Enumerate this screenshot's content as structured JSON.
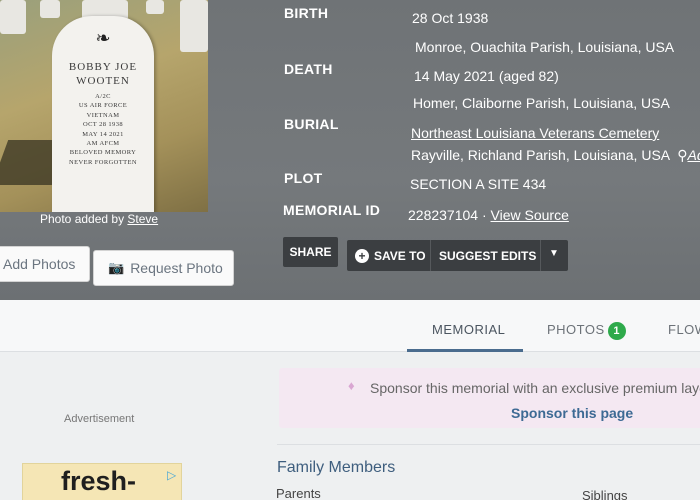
{
  "photo": {
    "headstone": {
      "name_line1": "BOBBY JOE",
      "name_line2": "WOOTEN",
      "lines": [
        "A/2C",
        "US AIR FORCE",
        "VIETNAM",
        "OCT 28 1938",
        "MAY 14 2021",
        "AM AFCM",
        "BELOVED MEMORY",
        "NEVER FORGOTTEN"
      ]
    },
    "credit_prefix": "Photo added by",
    "credit_user": "Steve",
    "add_photos_label": "Add Photos",
    "request_photo_label": "Request Photo"
  },
  "facts": {
    "birth_label": "BIRTH",
    "birth_date": "28 Oct 1938",
    "birth_place": "Monroe, Ouachita Parish, Louisiana, USA",
    "death_label": "DEATH",
    "death_date": "14 May 2021 (aged 82)",
    "death_place": "Homer, Claiborne Parish, Louisiana, USA",
    "burial_label": "BURIAL",
    "burial_cemetery": "Northeast Louisiana Veterans Cemetery",
    "burial_place": "Rayville, Richland Parish, Louisiana, USA",
    "burial_extra": "Ad",
    "plot_label": "PLOT",
    "plot_value": "SECTION A SITE 434",
    "memorial_id_label": "MEMORIAL ID",
    "memorial_id_value": "228237104 ·",
    "view_source": "View Source"
  },
  "actions": {
    "share": "SHARE",
    "save_to": "SAVE TO",
    "suggest_edits": "SUGGEST EDITS"
  },
  "tabs": {
    "memorial": "MEMORIAL",
    "photos": "PHOTOS",
    "photos_count": "1",
    "flowers": "FLOW"
  },
  "sponsor": {
    "text": "Sponsor this memorial with an exclusive premium layo",
    "link": "Sponsor this page"
  },
  "advertisement": {
    "label": "Advertisement",
    "text": "fresh-"
  },
  "family": {
    "title": "Family Members",
    "parents": "Parents",
    "siblings": "Siblings"
  }
}
